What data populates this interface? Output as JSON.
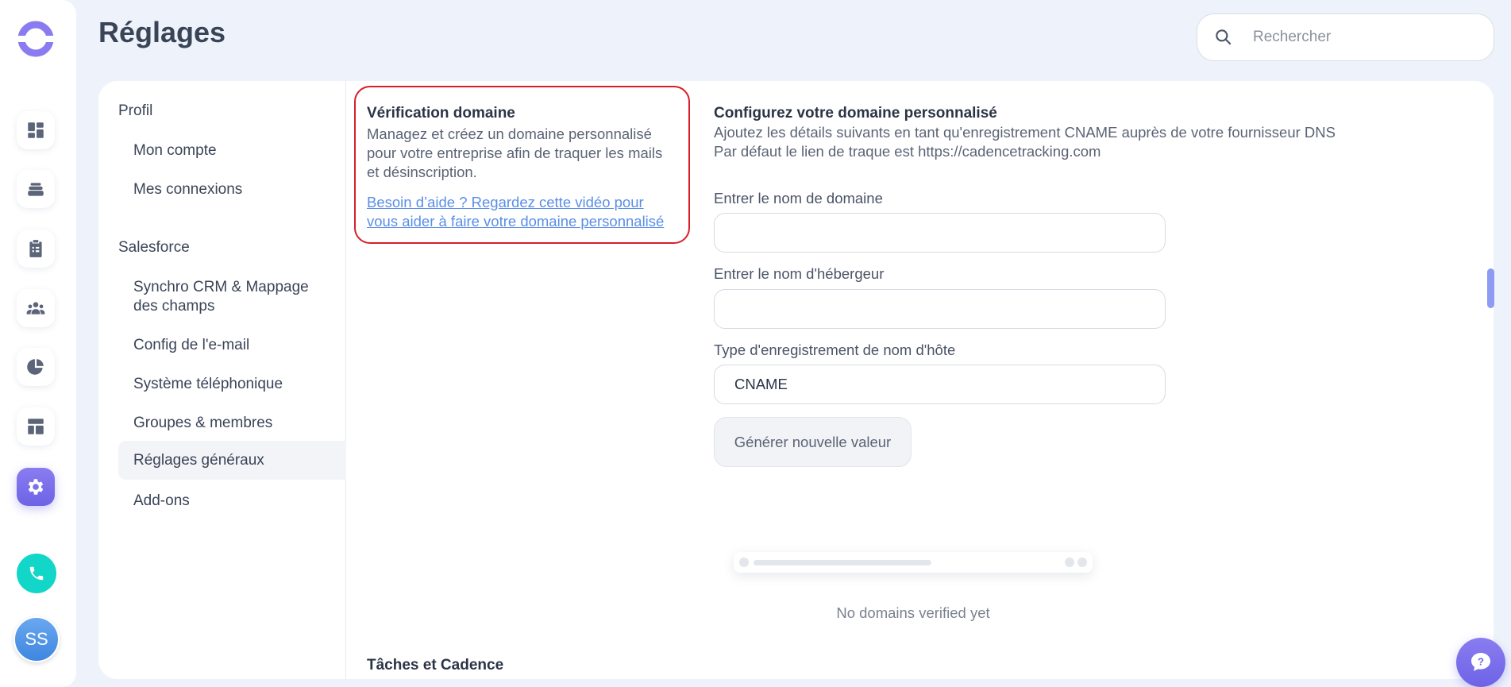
{
  "header": {
    "title": "Réglages",
    "search_placeholder": "Rechercher"
  },
  "rail": {
    "items": [
      "dashboard-icon",
      "stack-icon",
      "clipboard-icon",
      "people-icon",
      "pie-chart-icon",
      "layout-icon",
      "gear-icon"
    ],
    "active": "gear-icon",
    "phone": "phone-icon",
    "avatar_initials": "SS"
  },
  "settings_nav": {
    "groups": [
      {
        "label": "Profil",
        "items": [
          "Mon compte",
          "Mes connexions"
        ]
      },
      {
        "label": "Salesforce",
        "items": [
          "Synchro CRM & Mappage des champs",
          "Config de l'e-mail",
          "Système téléphonique",
          "Groupes & membres",
          "Réglages généraux",
          "Add-ons"
        ]
      }
    ],
    "active_item": "Réglages généraux"
  },
  "domain_section": {
    "title": "Vérification domaine",
    "description": "Managez et créez un domaine personnalisé pour votre entreprise afin de traquer les mails et désinscription.",
    "help_link": "Besoin d’aide ? Regardez cette vidéo pour vous aider à faire votre domaine personnalisé"
  },
  "config": {
    "title": "Configurez votre domaine personnalisé",
    "line1": "Ajoutez les détails suivants en tant qu'enregistrement CNAME auprès de votre fournisseur DNS",
    "line2": "Par défaut le lien de traque est https://cadencetracking.com",
    "fields": {
      "domain_label": "Entrer le nom de domaine",
      "domain_value": "",
      "host_label": "Entrer le nom d'hébergeur",
      "host_value": "",
      "record_type_label": "Type d'enregistrement de nom d'hôte",
      "record_type_value": "CNAME"
    },
    "generate_button": "Générer nouvelle valeur",
    "empty_state": "No domains verified yet"
  },
  "next_section_title": "Tâches et Cadence",
  "colors": {
    "accent": "#6d63e6",
    "highlight_border": "#d91d2a",
    "link": "#5a8ee6",
    "phone": "#12d6c7"
  }
}
